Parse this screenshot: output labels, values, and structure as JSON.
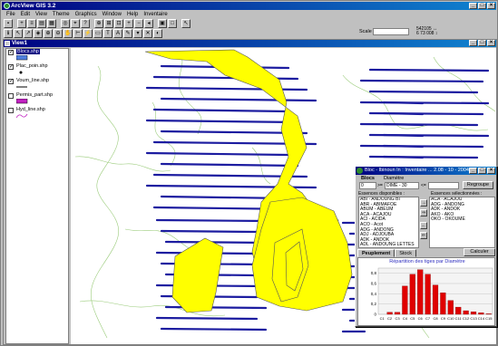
{
  "app": {
    "title": "ArcView GIS 3.2",
    "menus": [
      "File",
      "Edit",
      "View",
      "Theme",
      "Graphics",
      "Window",
      "Help",
      "Inventaire"
    ],
    "scale_label": "Scale 1:",
    "scale_value": "",
    "coords": [
      "542105 ↔",
      "6 73 008 ↕"
    ]
  },
  "view": {
    "title": "View1",
    "legend": [
      {
        "name": "Blocs.shp",
        "checked": true,
        "active": true,
        "symbol": "rect",
        "color": "#5080e0"
      },
      {
        "name": "Plac_poin.shp",
        "checked": true,
        "active": false,
        "symbol": "dot",
        "color": "#000000"
      },
      {
        "name": "Voum_line.shp",
        "checked": true,
        "active": false,
        "symbol": "line",
        "color": "#000000"
      },
      {
        "name": "Permis_part.shp",
        "checked": false,
        "active": false,
        "symbol": "rect",
        "color": "#c020c0"
      },
      {
        "name": "Hyd_line.shp",
        "checked": false,
        "active": false,
        "symbol": "wave",
        "color": "#c020c0"
      }
    ]
  },
  "dialog": {
    "title": "Bloc - Ibinoun In : Inventaire ... 2.08 - 10 - 2004",
    "blocs_label": "Blocs",
    "diametre_label": "Diamètre",
    "blocs_value": "0",
    "ge_label": ">=",
    "diametre_value": "DIME - 30",
    "lt_label": "<=",
    "regrouper_label": "Regroupe",
    "available_label": "Essences disponibles :",
    "selected_label": "Essences sélectionnées :",
    "available": [
      "ABI - ANDOUNG BI",
      "ABR - ABIMAFOE",
      "ABUM - ABEUM",
      "ACA - ACAJOU",
      "ACI - ACIDA",
      "ACO - Acot",
      "ADG - ANDONG",
      "ADJ - ADJOUBA",
      "ADK - ANDOK",
      "ADL - ANDOUNG LETTES"
    ],
    "selected": [
      "ACA - ACAJOU",
      "ADG - ANDONG",
      "ADK - ANDOK",
      "AKO - AKO",
      "OKO - OKOUME"
    ],
    "arrows": [
      "→",
      "⇒",
      "←",
      "⇐"
    ],
    "tabs": [
      "Peuplement",
      "Stock"
    ],
    "calc_label": "Calculer",
    "chart_title": "Répartition des tiges par Diamètre"
  },
  "chart_data": {
    "type": "bar",
    "title": "Répartition des tiges par Diamètre",
    "categories": [
      "C1",
      "C2",
      "C3",
      "C4",
      "C5",
      "C6",
      "C7",
      "C8",
      "C9",
      "C10",
      "C11",
      "C12",
      "C13",
      "C14",
      "C15"
    ],
    "values": [
      0,
      0.04,
      0.04,
      0.55,
      0.78,
      0.87,
      0.78,
      0.57,
      0.42,
      0.27,
      0.14,
      0.07,
      0.05,
      0.03,
      0.01
    ],
    "yticks": [
      "0",
      "0,2",
      "0,4",
      "0,6",
      "0,8"
    ],
    "ylim": [
      0,
      0.9
    ],
    "color": "#e00000",
    "grid": true
  }
}
